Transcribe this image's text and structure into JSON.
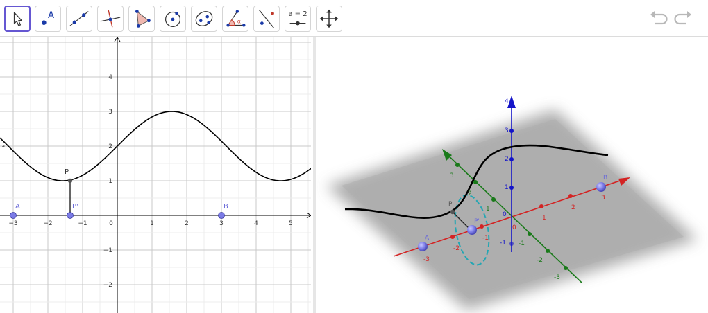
{
  "toolbar": {
    "tools": [
      {
        "id": "move",
        "icon": "move-arrow-icon",
        "active": true
      },
      {
        "id": "point",
        "icon": "point-icon",
        "label": "A"
      },
      {
        "id": "line",
        "icon": "line-through-two-points-icon"
      },
      {
        "id": "perpendicular",
        "icon": "perpendicular-line-icon"
      },
      {
        "id": "polygon",
        "icon": "polygon-icon"
      },
      {
        "id": "circle",
        "icon": "circle-center-point-icon"
      },
      {
        "id": "ellipse",
        "icon": "ellipse-icon"
      },
      {
        "id": "angle",
        "icon": "angle-icon",
        "label": "α"
      },
      {
        "id": "reflect",
        "icon": "reflect-about-line-icon"
      },
      {
        "id": "slider",
        "icon": "slider-icon",
        "label": "a = 2"
      },
      {
        "id": "move-graphics",
        "icon": "move-graphics-view-icon"
      }
    ],
    "undo_icon": "undo-icon",
    "redo_icon": "redo-icon"
  },
  "graphics2d": {
    "function_label": "f",
    "x_ticks": [
      "−3",
      "−2",
      "−1",
      "0",
      "1",
      "2",
      "3",
      "4",
      "5"
    ],
    "y_ticks": [
      "−2",
      "−1",
      "1",
      "2",
      "3",
      "4"
    ],
    "points": [
      {
        "name": "A",
        "x": -3,
        "y": 0,
        "color": "#7b7be6"
      },
      {
        "name": "B",
        "x": 3,
        "y": 0,
        "color": "#7b7be6"
      },
      {
        "name": "P'",
        "x": -1.2,
        "y": 0,
        "color": "#7b7be6"
      },
      {
        "name": "P",
        "x": -1.2,
        "y": 1,
        "color": "#555555"
      }
    ]
  },
  "graphics3d": {
    "z_ticks": [
      "4",
      "3",
      "2",
      "1",
      "0",
      "-1"
    ],
    "x_ticks": [
      "0",
      "1",
      "2",
      "3",
      "-1",
      "-2",
      "-3"
    ],
    "y_ticks": [
      "3",
      "2",
      "1",
      "-1",
      "-2",
      "-3"
    ],
    "point_labels": [
      "A",
      "B",
      "P",
      "P'"
    ],
    "colors": {
      "x_axis": "#d32323",
      "y_axis": "#1a7a1a",
      "z_axis": "#1414c8",
      "circle": "#22a6b3"
    }
  }
}
